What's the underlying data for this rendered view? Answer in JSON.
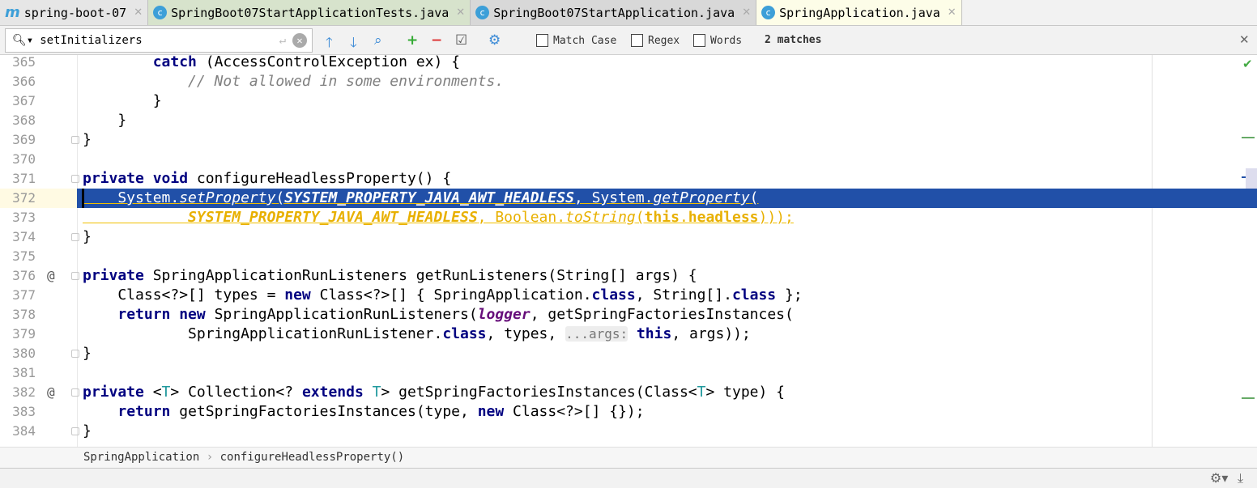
{
  "tabs": [
    {
      "label": "spring-boot-07",
      "icon": "maven-module-icon"
    },
    {
      "label": "SpringBoot07StartApplicationTests.java",
      "icon": "java-class-icon"
    },
    {
      "label": "SpringBoot07StartApplication.java",
      "icon": "spring-boot-class-icon"
    },
    {
      "label": "SpringApplication.java",
      "icon": "java-class-icon",
      "active": true
    }
  ],
  "find": {
    "value": "setInitializers",
    "match_case": "Match Case",
    "regex": "Regex",
    "words": "Words",
    "matches": "2 matches"
  },
  "lines": [
    {
      "n": "365",
      "t": [
        [
          "        "
        ],
        [
          "catch",
          "kw"
        ],
        [
          " (AccessControlException ex) {"
        ]
      ]
    },
    {
      "n": "366",
      "t": [
        [
          "            "
        ],
        [
          "// Not allowed in some environments.",
          "cm"
        ]
      ]
    },
    {
      "n": "367",
      "t": [
        [
          "        }"
        ]
      ]
    },
    {
      "n": "368",
      "t": [
        [
          "    }"
        ]
      ]
    },
    {
      "n": "369",
      "t": [
        [
          "}"
        ]
      ],
      "fold": true
    },
    {
      "n": "370",
      "t": [
        [
          ""
        ]
      ]
    },
    {
      "n": "371",
      "t": [
        [
          "private void",
          "kw"
        ],
        [
          " configureHeadlessProperty() {"
        ]
      ],
      "fold": true
    },
    {
      "n": "372",
      "t": [
        [
          "    System."
        ],
        [
          "setProperty",
          "it"
        ],
        [
          "("
        ],
        [
          "SYSTEM_PROPERTY_JAVA_AWT_HEADLESS",
          "cst"
        ],
        [
          ", System."
        ],
        [
          "getProperty",
          "it"
        ],
        [
          "("
        ]
      ],
      "selected": true
    },
    {
      "n": "373",
      "t": [
        [
          "            "
        ],
        [
          "SYSTEM_PROPERTY_JAVA_AWT_HEADLESS",
          "cst"
        ],
        [
          ", Boolean."
        ],
        [
          "toString",
          "it"
        ],
        [
          "("
        ],
        [
          "this",
          "kw"
        ],
        [
          "."
        ],
        [
          "headless",
          "fld"
        ],
        [
          ")));"
        ]
      ],
      "warn": true
    },
    {
      "n": "374",
      "t": [
        [
          "}"
        ]
      ],
      "fold": true
    },
    {
      "n": "375",
      "t": [
        [
          ""
        ]
      ]
    },
    {
      "n": "376",
      "t": [
        [
          "private",
          "kw"
        ],
        [
          " SpringApplicationRunListeners getRunListeners(String[] args) {"
        ]
      ],
      "fold": true,
      "at": true
    },
    {
      "n": "377",
      "t": [
        [
          "    Class<?>[] types = "
        ],
        [
          "new",
          "kw"
        ],
        [
          " Class<?>[] { SpringApplication."
        ],
        [
          "class",
          "kw"
        ],
        [
          ", String[]."
        ],
        [
          "class",
          "kw"
        ],
        [
          " };"
        ]
      ]
    },
    {
      "n": "378",
      "t": [
        [
          "    "
        ],
        [
          "return new",
          "kw"
        ],
        [
          " SpringApplicationRunListeners("
        ],
        [
          "logger",
          "cst"
        ],
        [
          ", getSpringFactoriesInstances("
        ]
      ]
    },
    {
      "n": "379",
      "t": [
        [
          "            SpringApplicationRunListener."
        ],
        [
          "class",
          "kw"
        ],
        [
          ", types, "
        ],
        [
          "...args:",
          "hint"
        ],
        [
          " "
        ],
        [
          "this",
          "kw"
        ],
        [
          ", args));"
        ]
      ]
    },
    {
      "n": "380",
      "t": [
        [
          "}"
        ]
      ],
      "fold": true
    },
    {
      "n": "381",
      "t": [
        [
          ""
        ]
      ]
    },
    {
      "n": "382",
      "t": [
        [
          "private",
          "kw"
        ],
        [
          " <"
        ],
        [
          "T",
          "tp"
        ],
        [
          "> Collection<? "
        ],
        [
          "extends",
          "kw"
        ],
        [
          " "
        ],
        [
          "T",
          "tp"
        ],
        [
          "> getSpringFactoriesInstances(Class<"
        ],
        [
          "T",
          "tp"
        ],
        [
          "> type) {"
        ]
      ],
      "fold": true,
      "at": true
    },
    {
      "n": "383",
      "t": [
        [
          "    "
        ],
        [
          "return",
          "kw"
        ],
        [
          " getSpringFactoriesInstances(type, "
        ],
        [
          "new",
          "kw"
        ],
        [
          " Class<?>[] {});"
        ]
      ]
    },
    {
      "n": "384",
      "t": [
        [
          "}"
        ]
      ],
      "fold": true
    }
  ],
  "breadcrumb": [
    "SpringApplication",
    "configureHeadlessProperty()"
  ],
  "colors": {
    "selection": "#2150a8",
    "keyword": "#000080",
    "constant": "#660e7a"
  }
}
